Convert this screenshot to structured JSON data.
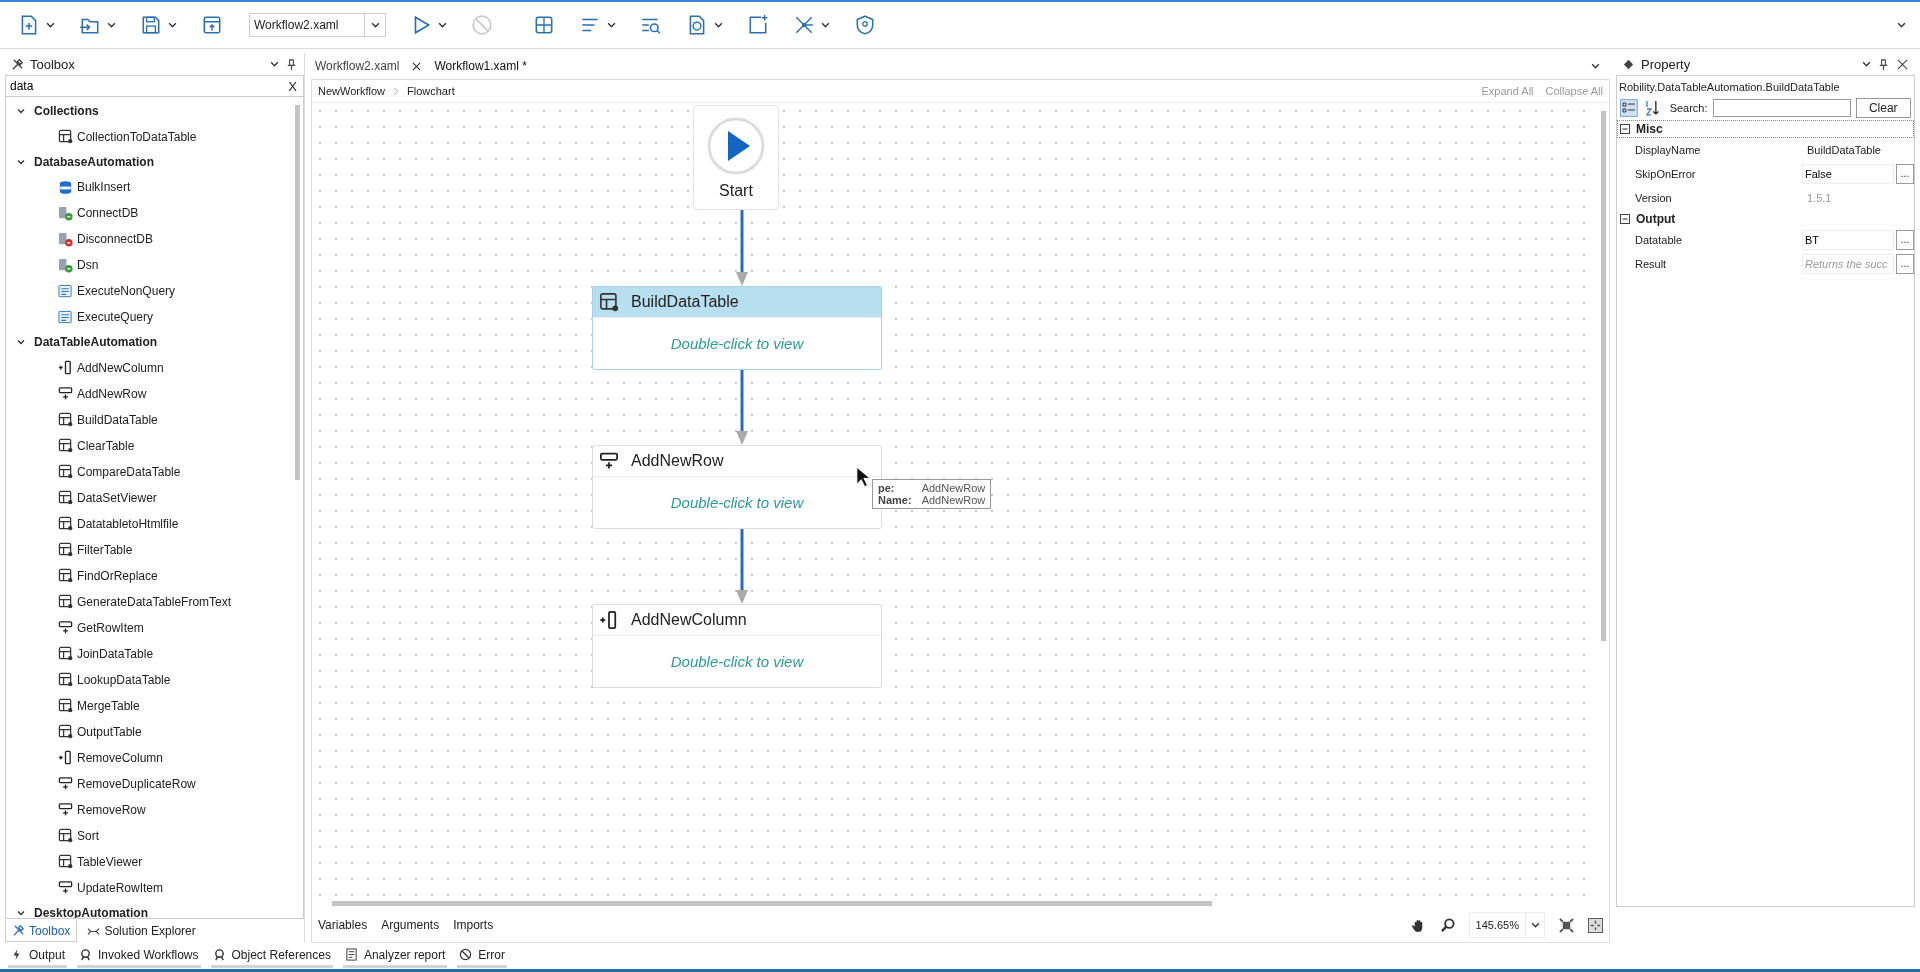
{
  "toolbar": {
    "workflow_select": "Workflow2.xaml"
  },
  "toolbox": {
    "title": "Toolbox",
    "search": "data",
    "clear": "X",
    "categories": [
      {
        "label": "Collections",
        "expanded": true,
        "children": [
          {
            "label": "CollectionToDataTable",
            "kind": "table"
          }
        ]
      },
      {
        "label": "DatabaseAutomation",
        "expanded": true,
        "children": [
          {
            "label": "BulkInsert",
            "kind": "sql"
          },
          {
            "label": "ConnectDB",
            "kind": "db-connect"
          },
          {
            "label": "DisconnectDB",
            "kind": "db-disconnect"
          },
          {
            "label": "Dsn",
            "kind": "db-connect"
          },
          {
            "label": "ExecuteNonQuery",
            "kind": "query"
          },
          {
            "label": "ExecuteQuery",
            "kind": "query"
          }
        ]
      },
      {
        "label": "DataTableAutomation",
        "expanded": true,
        "children": [
          {
            "label": "AddNewColumn",
            "kind": "column"
          },
          {
            "label": "AddNewRow",
            "kind": "row"
          },
          {
            "label": "BuildDataTable",
            "kind": "table"
          },
          {
            "label": "ClearTable",
            "kind": "table"
          },
          {
            "label": "CompareDataTable",
            "kind": "table"
          },
          {
            "label": "DataSetViewer",
            "kind": "table"
          },
          {
            "label": "DatatabletoHtmlfile",
            "kind": "table"
          },
          {
            "label": "FilterTable",
            "kind": "table"
          },
          {
            "label": "FindOrReplace",
            "kind": "table"
          },
          {
            "label": "GenerateDataTableFromText",
            "kind": "table"
          },
          {
            "label": "GetRowItem",
            "kind": "row"
          },
          {
            "label": "JoinDataTable",
            "kind": "table"
          },
          {
            "label": "LookupDataTable",
            "kind": "table"
          },
          {
            "label": "MergeTable",
            "kind": "table"
          },
          {
            "label": "OutputTable",
            "kind": "table"
          },
          {
            "label": "RemoveColumn",
            "kind": "column"
          },
          {
            "label": "RemoveDuplicateRow",
            "kind": "row"
          },
          {
            "label": "RemoveRow",
            "kind": "row"
          },
          {
            "label": "Sort",
            "kind": "table"
          },
          {
            "label": "TableViewer",
            "kind": "table"
          },
          {
            "label": "UpdateRowItem",
            "kind": "row"
          }
        ]
      },
      {
        "label": "DesktopAutomation",
        "expanded": true
      }
    ]
  },
  "panel_tabs": [
    {
      "label": "Toolbox",
      "selected": true
    },
    {
      "label": "Solution Explorer",
      "selected": false
    }
  ],
  "doc_tabs": [
    {
      "label": "Workflow2.xaml",
      "selected": false
    },
    {
      "label": "Workflow1.xaml *",
      "selected": true
    }
  ],
  "breadcrumb": [
    "NewWorkflow",
    "Flowchart"
  ],
  "view_actions": [
    "Expand All",
    "Collapse All"
  ],
  "flowchart": {
    "start": "Start",
    "nodes": [
      {
        "title": "BuildDataTable",
        "kind": "table",
        "hint": "Double-click to view",
        "selected": true
      },
      {
        "title": "AddNewRow",
        "kind": "row",
        "hint": "Double-click to view",
        "selected": false
      },
      {
        "title": "AddNewColumn",
        "kind": "column",
        "hint": "Double-click to view",
        "selected": false
      }
    ],
    "tooltip": [
      {
        "label": "pe:",
        "value": "AddNewRow"
      },
      {
        "label": "Name:",
        "value": "AddNewRow"
      }
    ]
  },
  "designer_tabs": [
    "Variables",
    "Arguments",
    "Imports"
  ],
  "zoom": "145.65%",
  "property": {
    "title": "Property",
    "type_name": "Robility.DataTableAutomation.BuildDataTable",
    "search_label": "Search:",
    "clear": "Clear",
    "groups": [
      {
        "label": "Misc",
        "expanded": true,
        "rows": [
          {
            "name": "DisplayName",
            "kind": "text",
            "value": "BuildDataTable"
          },
          {
            "name": "SkipOnError",
            "kind": "field",
            "value": "False",
            "more": "..."
          },
          {
            "name": "Version",
            "kind": "readonly",
            "value": "1.5.1"
          }
        ]
      },
      {
        "label": "Output",
        "expanded": true,
        "rows": [
          {
            "name": "Datatable",
            "kind": "field",
            "value": "BT",
            "more": "..."
          },
          {
            "name": "Result",
            "kind": "field",
            "placeholder": "Returns the succ",
            "more": "..."
          }
        ]
      }
    ]
  },
  "output_tabs": [
    "Output",
    "Invoked Workflows",
    "Object References",
    "Analyzer report",
    "Error"
  ]
}
